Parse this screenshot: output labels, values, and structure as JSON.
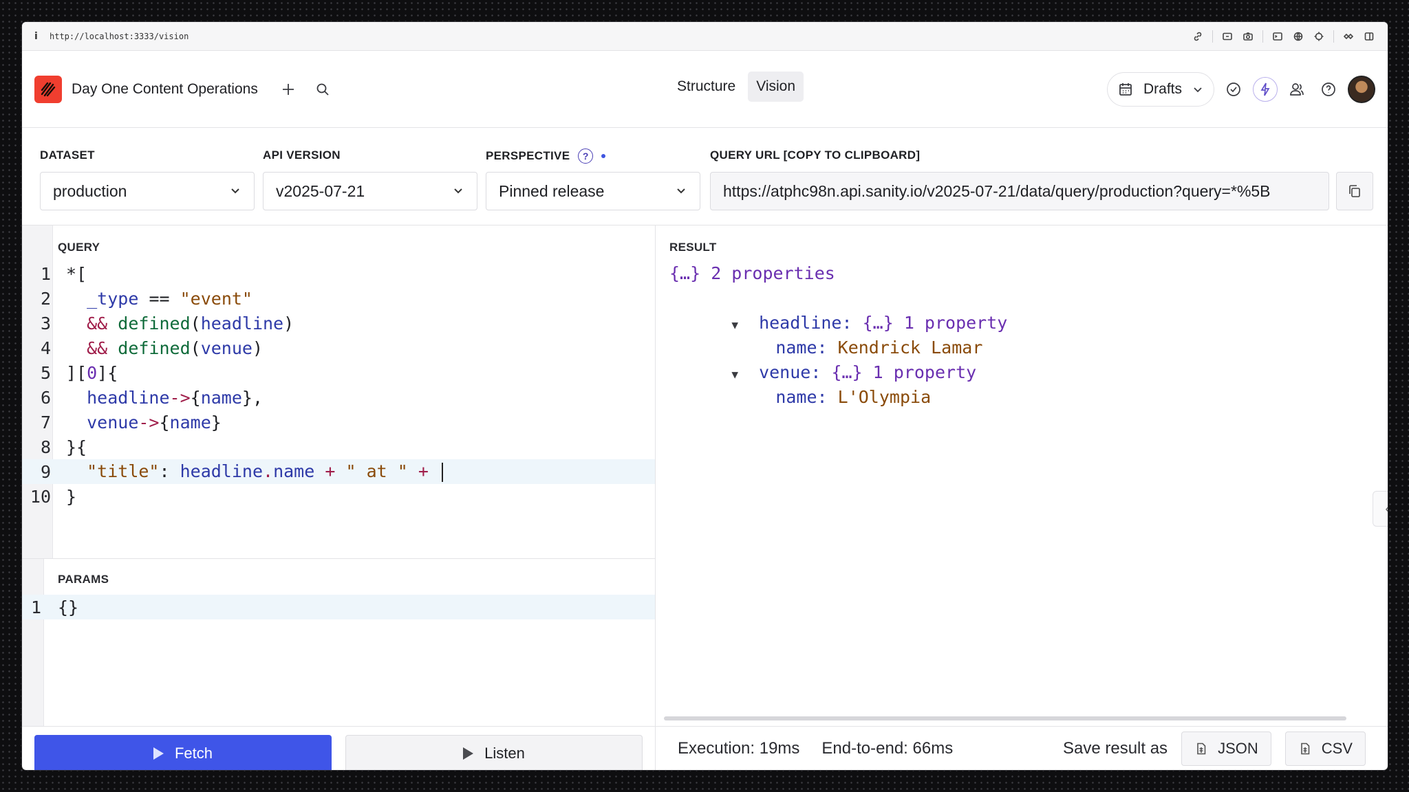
{
  "browser": {
    "info_glyph": "i",
    "url": "http://localhost:3333/vision"
  },
  "header": {
    "workspace": "Day One Content Operations",
    "tabs": [
      {
        "label": "Structure",
        "active": false
      },
      {
        "label": "Vision",
        "active": true
      }
    ],
    "perspective_menu": "Drafts"
  },
  "controls": {
    "dataset_label": "DATASET",
    "dataset_value": "production",
    "api_label": "API VERSION",
    "api_value": "v2025-07-21",
    "perspective_label": "PERSPECTIVE",
    "perspective_help": "?",
    "perspective_value": "Pinned release",
    "query_url_label": "QUERY URL [COPY TO CLIPBOARD]",
    "query_url_value": "https://atphc98n.api.sanity.io/v2025-07-21/data/query/production?query=*%5B"
  },
  "query": {
    "label": "QUERY",
    "line_numbers": [
      "1",
      "2",
      "3",
      "4",
      "5",
      "6",
      "7",
      "8",
      "9",
      "10"
    ]
  },
  "params": {
    "label": "PARAMS",
    "line_numbers": [
      "1"
    ],
    "content": "{}"
  },
  "result": {
    "label": "RESULT",
    "summary": "{…} 2 properties",
    "items": [
      {
        "key": "headline",
        "summary": "{…} 1 property",
        "child_key": "name",
        "child_value": "Kendrick Lamar"
      },
      {
        "key": "venue",
        "summary": "{…} 1 property",
        "child_key": "name",
        "child_value": "L'Olympia"
      }
    ]
  },
  "actions": {
    "fetch": "Fetch",
    "listen": "Listen"
  },
  "stats": {
    "execution": "Execution: 19ms",
    "end_to_end": "End-to-end: 66ms",
    "save_as": "Save result as",
    "json": "JSON",
    "csv": "CSV"
  },
  "colors": {
    "accent": "#3f55e8",
    "brand": "#f03e2f"
  }
}
